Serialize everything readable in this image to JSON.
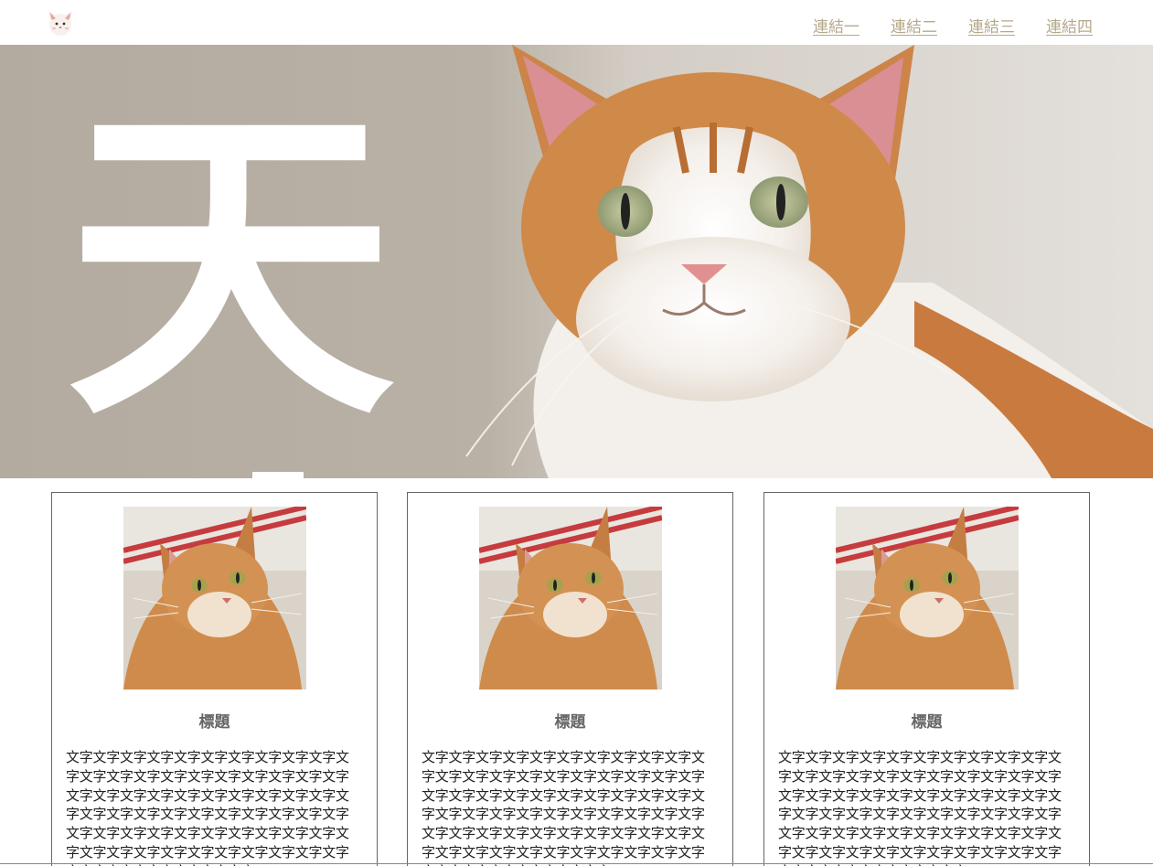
{
  "header": {
    "logo_icon": "cat-face-icon",
    "nav": [
      {
        "label": "連結一"
      },
      {
        "label": "連結二"
      },
      {
        "label": "連結三"
      },
      {
        "label": "連結四"
      }
    ],
    "nav_color": "#b6a88b"
  },
  "hero": {
    "image": "cat-hero-image",
    "overlay_char": "天"
  },
  "cards": [
    {
      "title": "標題",
      "image": "orange-cat-photo",
      "text": "文字文字文字文字文字文字文字文字文字文字文字文字文字文字文字文字文字文字文字文字文字文字文字文字文字文字文字文字文字文字文字文字文字文字文字文字文字文字文字文字文字文字文字文字文字文字文字文字文字文字文字文字文字文字文字文字文字文字文字文字文字文字文字文字文字文字文字文字文字文字"
    },
    {
      "title": "標題",
      "image": "orange-cat-photo",
      "text": "文字文字文字文字文字文字文字文字文字文字文字文字文字文字文字文字文字文字文字文字文字文字文字文字文字文字文字文字文字文字文字文字文字文字文字文字文字文字文字文字文字文字文字文字文字文字文字文字文字文字文字文字文字文字文字文字文字文字文字文字文字文字文字文字文字文字文字文字文字文字"
    },
    {
      "title": "標題",
      "image": "orange-cat-photo",
      "text": "文字文字文字文字文字文字文字文字文字文字文字文字文字文字文字文字文字文字文字文字文字文字文字文字文字文字文字文字文字文字文字文字文字文字文字文字文字文字文字文字文字文字文字文字文字文字文字文字文字文字文字文字文字文字文字文字文字文字文字文字文字文字文字文字文字文字文字文字文字文字"
    }
  ]
}
